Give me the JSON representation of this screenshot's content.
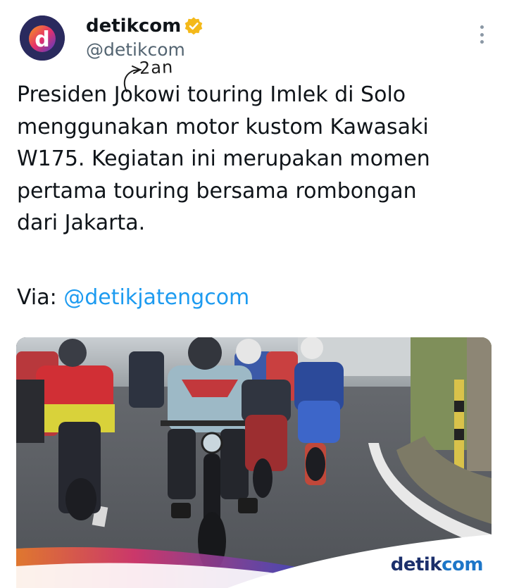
{
  "account": {
    "display_name": "detikcom",
    "handle": "@detikcom",
    "avatar_letter": "d",
    "verified": true
  },
  "tweet": {
    "text": "Presiden Jokowi touring Imlek di Solo\nmenggunakan motor kustom Kawasaki\nW175. Kegiatan ini merupakan momen\npertama touring bersama rombongan\ndari Jakarta.",
    "via_label": "Via: ",
    "mention": "@detikjatengcom",
    "handwritten_annotation": "2an"
  },
  "media": {
    "logo_part1": "detik",
    "logo_part2": "com",
    "description_icon": "photo-motorcycle-touring"
  },
  "colors": {
    "link": "#1d9bf0",
    "handle": "#536471",
    "verified_badge": "#f4b91a",
    "logo_dark": "#1b2f6b",
    "logo_blue": "#1d76c8"
  },
  "icons": {
    "more": "more-vertical-icon",
    "verified": "verified-badge-icon"
  }
}
